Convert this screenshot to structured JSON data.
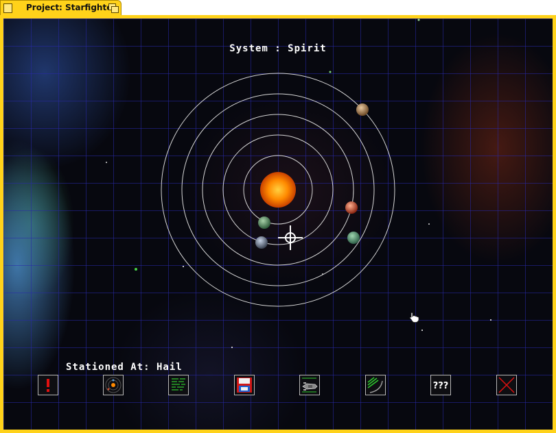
{
  "window": {
    "title": "Project: Starfighter"
  },
  "hud": {
    "system_label": "System : Spirit",
    "station_label": "Stationed At: Hail"
  },
  "system": {
    "sun_color": "#ff8a00",
    "planets": [
      {
        "orbit": 1,
        "color": "#5f8f6a"
      },
      {
        "orbit": 2,
        "color": "#7c8aa0"
      },
      {
        "orbit": 3,
        "color": "#5e9a78"
      },
      {
        "orbit": 4,
        "color": "#d0502a"
      },
      {
        "orbit": 5,
        "color": "#b88a58"
      }
    ]
  },
  "toolbar": {
    "buttons": [
      {
        "name": "alert-button",
        "icon": "exclamation-icon"
      },
      {
        "name": "starmap-button",
        "icon": "solar-system-icon"
      },
      {
        "name": "status-button",
        "icon": "status-screen-icon"
      },
      {
        "name": "save-button",
        "icon": "floppy-disk-icon"
      },
      {
        "name": "upgrade-ship-button",
        "icon": "ship-icon"
      },
      {
        "name": "weapons-button",
        "icon": "weapon-icon"
      },
      {
        "name": "help-button",
        "icon": "question-marks-icon",
        "label": "???"
      },
      {
        "name": "exit-button",
        "icon": "red-x-icon"
      }
    ]
  },
  "colors": {
    "frame": "#ffd21a",
    "grid": "#2828aa",
    "text": "#ffffff",
    "orbit": "#d8d8d8"
  }
}
